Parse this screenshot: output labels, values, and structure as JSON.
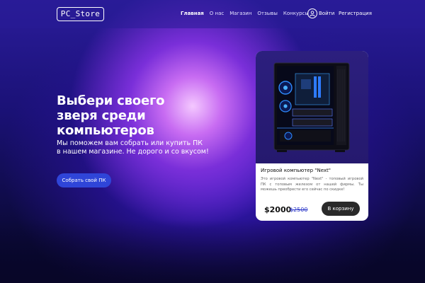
{
  "header": {
    "logo": "PC_Store",
    "nav": [
      "Главная",
      "О нас",
      "Магазин",
      "Отзывы",
      "Конкурсы"
    ],
    "login": "Войти",
    "register": "Регистрация"
  },
  "hero": {
    "title_lines": [
      "Выбери своего",
      "зверя среди",
      "компьютеров"
    ],
    "subtitle_lines": [
      "Мы поможем вам собрать или купить ПК",
      "в нашем магазине. Не дорого и со вкусом!"
    ],
    "cta": "Собрать свой ПК"
  },
  "card": {
    "title": "Игровой компьютер \"Next\"",
    "description": "Это игровой компьютер \"Next\" - топовый игровой ПК с топовым железом от нашей фирмы. Ты можешь преобрести его сейчас по скидке!",
    "price": "$2000",
    "old_price": "$2500",
    "buy": "В корзину"
  },
  "colors": {
    "accent": "#2f45d8",
    "old_price": "#2a36c9",
    "buy_button": "#2a2a2a"
  },
  "icons": {
    "user": "user-icon"
  }
}
